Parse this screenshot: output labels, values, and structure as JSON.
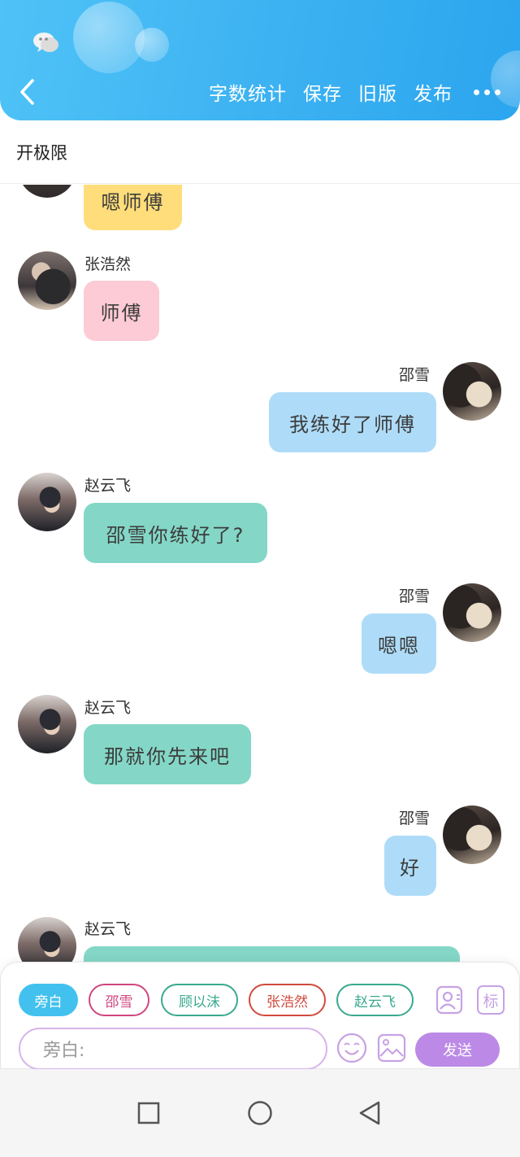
{
  "header": {
    "actions": [
      "字数统计",
      "保存",
      "旧版",
      "发布"
    ],
    "accent": "#3fb4f2"
  },
  "title": "开极限",
  "messages": [
    {
      "side": "left",
      "name": "",
      "text": "嗯师傅",
      "color": "#fedd7a"
    },
    {
      "side": "left",
      "name": "张浩然",
      "text": "师傅",
      "color": "#fccbd5"
    },
    {
      "side": "right",
      "name": "邵雪",
      "text": "我练好了师傅",
      "color": "#aedcf8"
    },
    {
      "side": "left",
      "name": "赵云飞",
      "text": "邵雪你练好了?",
      "color": "#84d7c7"
    },
    {
      "side": "right",
      "name": "邵雪",
      "text": "嗯嗯",
      "color": "#aedcf8"
    },
    {
      "side": "left",
      "name": "赵云飞",
      "text": "那就你先来吧",
      "color": "#84d7c7"
    },
    {
      "side": "right",
      "name": "邵雪",
      "text": "好",
      "color": "#aedcf8"
    },
    {
      "side": "left",
      "name": "赵云飞",
      "text": "",
      "color": "#84d7c7"
    }
  ],
  "panel": {
    "roles": [
      {
        "label": "旁白",
        "active": true,
        "color": "#42c1ee"
      },
      {
        "label": "邵雪",
        "active": false,
        "color": "#d0467f"
      },
      {
        "label": "顾以沫",
        "active": false,
        "color": "#3aa98f"
      },
      {
        "label": "张浩然",
        "active": false,
        "color": "#d14a3e"
      },
      {
        "label": "赵云飞",
        "active": false,
        "color": "#3aa98f"
      }
    ],
    "tag_icon_label": "标",
    "input_placeholder": "旁白:",
    "send_label": "发送",
    "send_color": "#bc8ae6"
  },
  "icons": [
    "wechat-icon",
    "back-icon",
    "more-icon",
    "contact-icon",
    "tag-icon",
    "emoji-icon",
    "image-icon",
    "square-icon",
    "circle-icon",
    "triangle-back-icon"
  ]
}
